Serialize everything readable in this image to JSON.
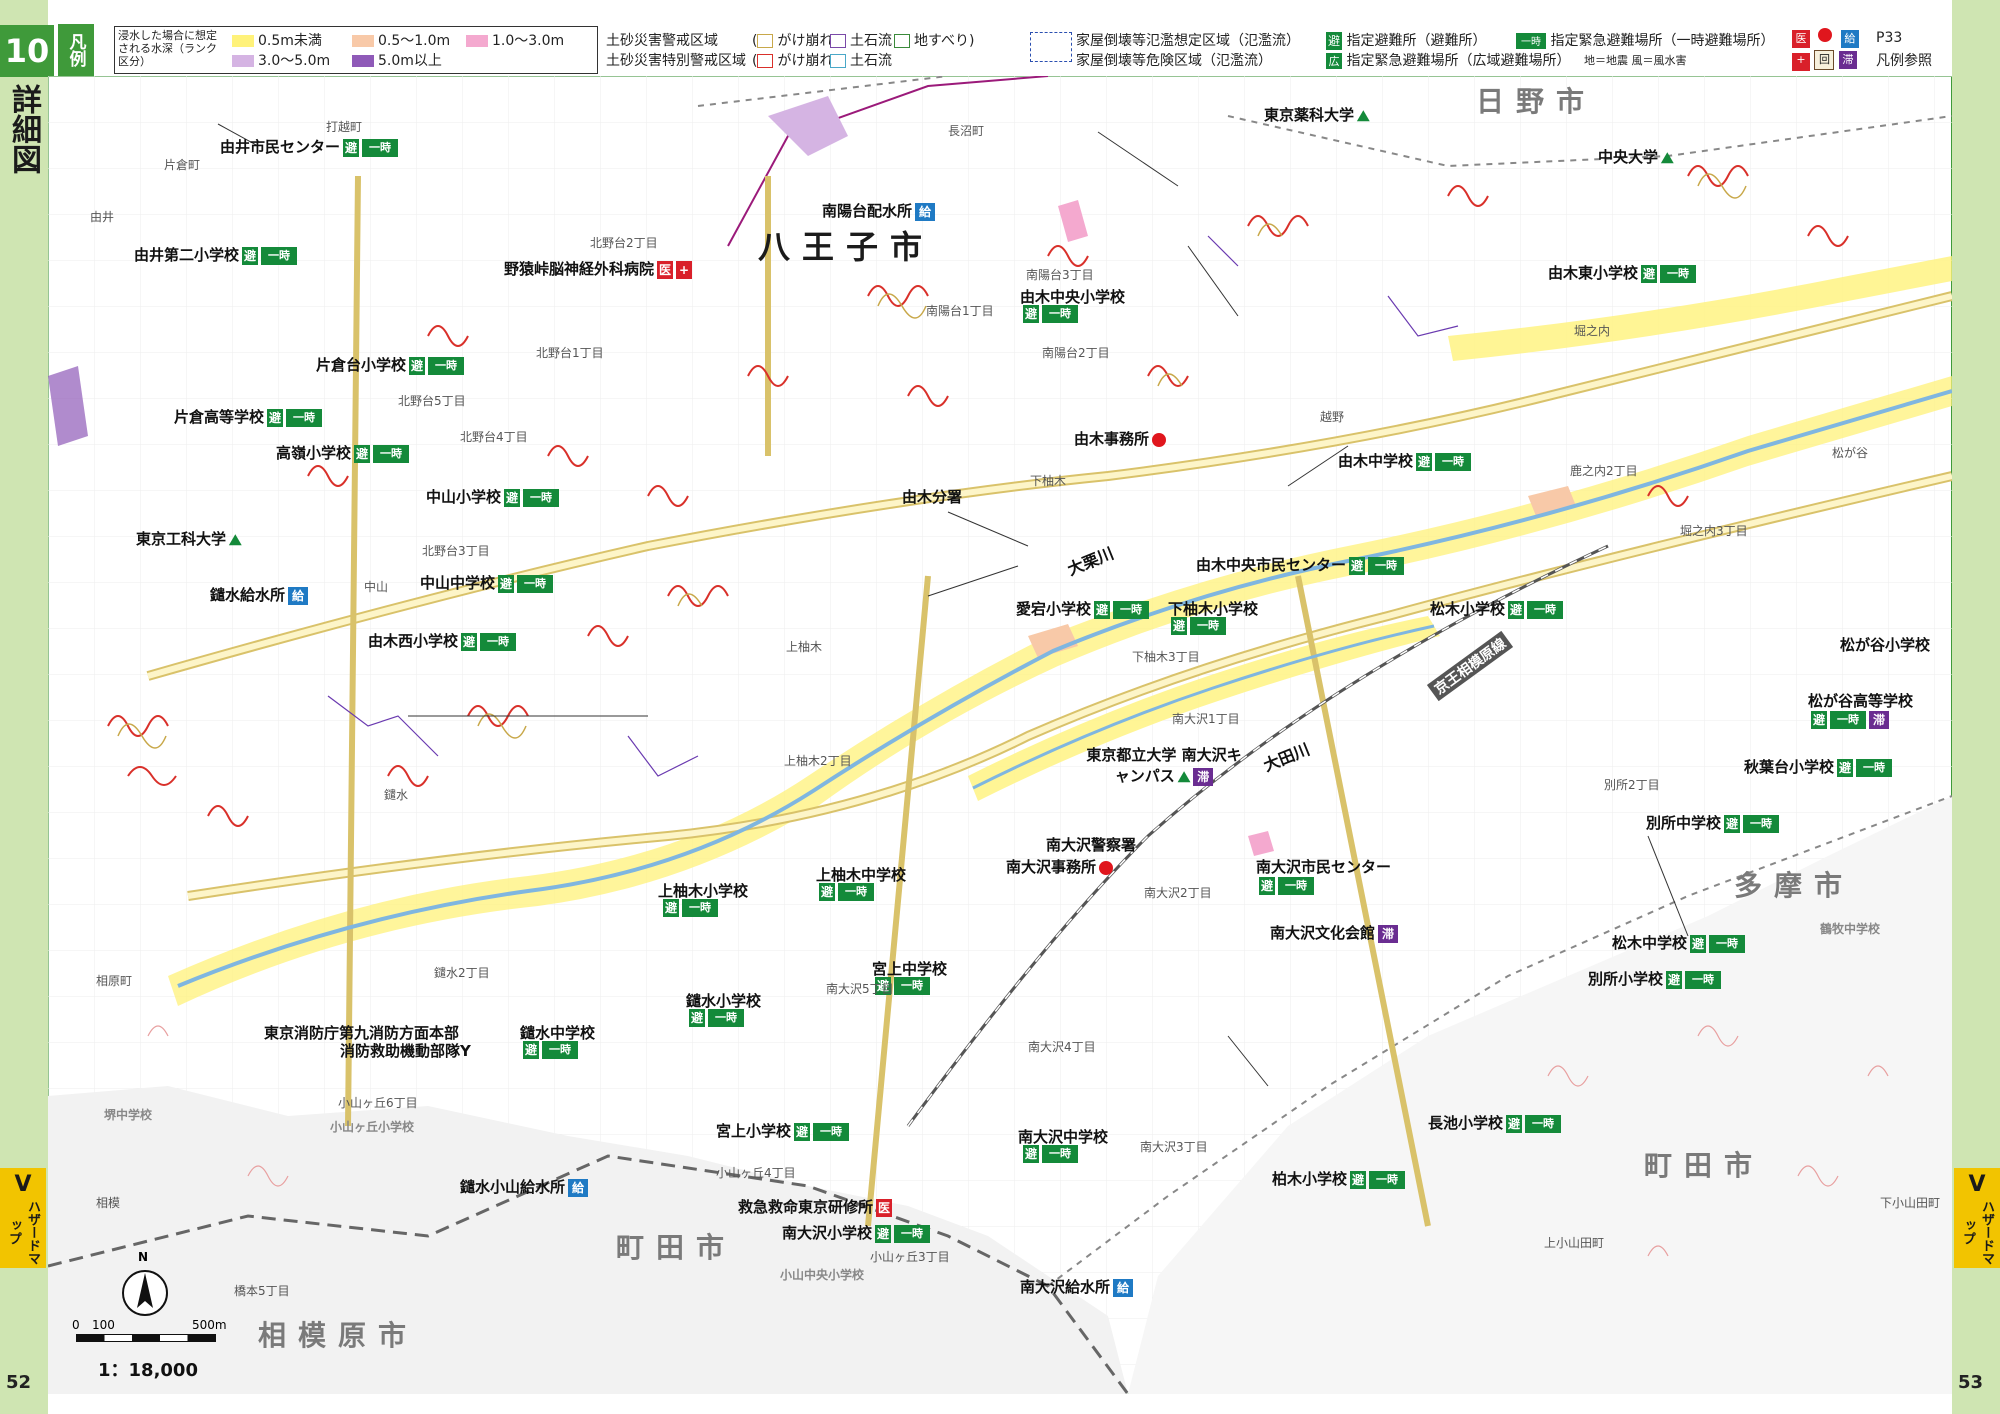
{
  "page": {
    "number": "10",
    "title": "詳細図",
    "left_page": "52",
    "right_page": "53",
    "side_tab_letter": "V",
    "side_tab_text": "ハザードマップ"
  },
  "legend": {
    "label": "凡例",
    "flood_title": "浸水した場合に想定される水深（ランク区分）",
    "flood_classes": [
      {
        "label": "0.5m未満",
        "color": "#fff27a"
      },
      {
        "label": "0.5〜1.0m",
        "color": "#f8c9a8"
      },
      {
        "label": "1.0〜3.0m",
        "color": "#f4a9cf"
      },
      {
        "label": "3.0〜5.0m",
        "color": "#d5b4e3"
      },
      {
        "label": "5.0m以上",
        "color": "#8f5ab8"
      }
    ],
    "sediment_warning": "土砂災害警戒区域",
    "sediment_special": "土砂災害特別警戒区域",
    "cliff": "がけ崩れ",
    "debris_flow": "土石流",
    "landslide": "地すべり",
    "collapse_flood": "家屋倒壊等氾濫想定区域（氾濫流）",
    "collapse_danger": "家屋倒壊等危険区域（氾濫流）",
    "designated_shelter": "指定避難所（避難所）",
    "emergency_temp": "指定緊急避難場所（一時避難場所）",
    "emergency_wide": "指定緊急避難場所（広域避難場所）",
    "earthquake_flood_note": "地＝地震 風＝風水害",
    "ref_page": "P33",
    "ref_text": "凡例参照"
  },
  "cities": {
    "hachioji": "八王子市",
    "hino": "日野市",
    "tama": "多摩市",
    "machida_right": "町田市",
    "machida_bottom": "町田市",
    "sagamihara": "相模原市"
  },
  "rivers": {
    "ohkuri": "大栗川",
    "ohta": "大田川",
    "keio": "京王相模原線"
  },
  "facilities": [
    {
      "name": "由井市民センター",
      "badges": [
        "shelter",
        "temp"
      ]
    },
    {
      "name": "由井第二小学校",
      "badges": [
        "shelter",
        "temp"
      ]
    },
    {
      "name": "野猿峠脳神経外科病院",
      "badges": [
        "red",
        "redcross"
      ]
    },
    {
      "name": "南陽台配水所",
      "badges": [
        "kyu"
      ]
    },
    {
      "name": "東京薬科大学",
      "badges": [
        "wide"
      ]
    },
    {
      "name": "中央大学",
      "badges": [
        "wide"
      ]
    },
    {
      "name": "由木東小学校",
      "badges": [
        "shelter",
        "temp"
      ]
    },
    {
      "name": "由木中央小学校",
      "badges": []
    },
    {
      "name": "片倉台小学校",
      "badges": [
        "shelter",
        "temp"
      ]
    },
    {
      "name": "片倉高等学校",
      "badges": [
        "shelter",
        "temp"
      ]
    },
    {
      "name": "高嶺小学校",
      "badges": [
        "shelter",
        "temp"
      ]
    },
    {
      "name": "由木事務所",
      "badges": [
        "dot"
      ]
    },
    {
      "name": "中山小学校",
      "badges": [
        "shelter",
        "temp"
      ]
    },
    {
      "name": "由木分署",
      "badges": []
    },
    {
      "name": "由木中学校",
      "badges": [
        "shelter",
        "temp"
      ]
    },
    {
      "name": "東京工科大学",
      "badges": [
        "wide"
      ]
    },
    {
      "name": "中山中学校",
      "badges": [
        "shelter",
        "temp"
      ]
    },
    {
      "name": "由木中央市民センター",
      "badges": [
        "shelter",
        "temp"
      ]
    },
    {
      "name": "鑓水給水所",
      "badges": [
        "kyu"
      ]
    },
    {
      "name": "愛宕小学校",
      "badges": [
        "shelter",
        "temp"
      ]
    },
    {
      "name": "下柚木小学校",
      "badges": []
    },
    {
      "name": "松木小学校",
      "badges": [
        "shelter",
        "temp"
      ]
    },
    {
      "name": "由木西小学校",
      "badges": [
        "shelter",
        "temp"
      ]
    },
    {
      "name": "松が谷小学校",
      "badges": []
    },
    {
      "name": "松が谷高等学校",
      "badges": []
    },
    {
      "name": "東京都立大学 南大沢キャンパス",
      "badges": [
        "wide",
        "tai"
      ]
    },
    {
      "name": "秋葉台小学校",
      "badges": [
        "shelter",
        "temp"
      ]
    },
    {
      "name": "南大沢警察署",
      "badges": []
    },
    {
      "name": "別所中学校",
      "badges": [
        "shelter",
        "temp"
      ]
    },
    {
      "name": "南大沢事務所",
      "badges": [
        "dot"
      ]
    },
    {
      "name": "南大沢市民センター",
      "badges": []
    },
    {
      "name": "上柚木小学校",
      "badges": []
    },
    {
      "name": "上柚木中学校",
      "badges": []
    },
    {
      "name": "南大沢文化会館",
      "badges": [
        "tai"
      ]
    },
    {
      "name": "松木中学校",
      "badges": [
        "shelter",
        "temp"
      ]
    },
    {
      "name": "宮上中学校",
      "badges": []
    },
    {
      "name": "別所小学校",
      "badges": [
        "shelter",
        "temp"
      ]
    },
    {
      "name": "鑓水小学校",
      "badges": []
    },
    {
      "name": "東京消防庁第九消防方面本部",
      "badges": []
    },
    {
      "name": "消防救助機動部隊",
      "badges": []
    },
    {
      "name": "鑓水中学校",
      "badges": []
    },
    {
      "name": "長池小学校",
      "badges": [
        "shelter",
        "temp"
      ]
    },
    {
      "name": "宮上小学校",
      "badges": [
        "shelter",
        "temp"
      ]
    },
    {
      "name": "南大沢中学校",
      "badges": []
    },
    {
      "name": "柏木小学校",
      "badges": [
        "shelter",
        "temp"
      ]
    },
    {
      "name": "鑓水小山給水所",
      "badges": [
        "kyu"
      ]
    },
    {
      "name": "救急救命東京研修所",
      "badges": [
        "red"
      ]
    },
    {
      "name": "南大沢小学校",
      "badges": [
        "shelter",
        "temp"
      ]
    },
    {
      "name": "南大沢給水所",
      "badges": [
        "kyu"
      ]
    }
  ],
  "towns": [
    "打越町",
    "片倉町",
    "由井",
    "南陽台3丁目",
    "南陽台1丁目",
    "南陽台2丁目",
    "長沼町",
    "北野台2丁目",
    "北野台1丁目",
    "北野台5丁目",
    "北野台4丁目",
    "北野台3丁目",
    "中山",
    "下柚木",
    "越野",
    "鹿之内2丁目",
    "堀之内3丁目",
    "上柚木",
    "下柚木3丁目",
    "上柚木2丁目",
    "南大沢1丁目",
    "鑓水",
    "鑓水2丁目",
    "南大沢2丁目",
    "南大沢5丁目",
    "南大沢4丁目",
    "南大沢3丁目",
    "別所2丁目",
    "堀之内",
    "松が谷",
    "相原町",
    "小山ヶ丘6丁目",
    "小山ヶ丘4丁目",
    "小山ヶ丘3丁目",
    "相模",
    "橋本5丁目",
    "堺中学校",
    "小山ヶ丘小学校",
    "鶴牧中学校",
    "小山中央小学校",
    "上小山田町",
    "下小山田町"
  ],
  "scale": {
    "n": "N",
    "ticks": [
      "0",
      "100",
      "500m"
    ],
    "ratio": "1：18,000"
  },
  "icons": [
    "shelter-icon",
    "temp-shelter-icon",
    "wide-area-icon",
    "hospital-icon",
    "water-station-icon",
    "office-dot-icon",
    "north-arrow-icon"
  ]
}
